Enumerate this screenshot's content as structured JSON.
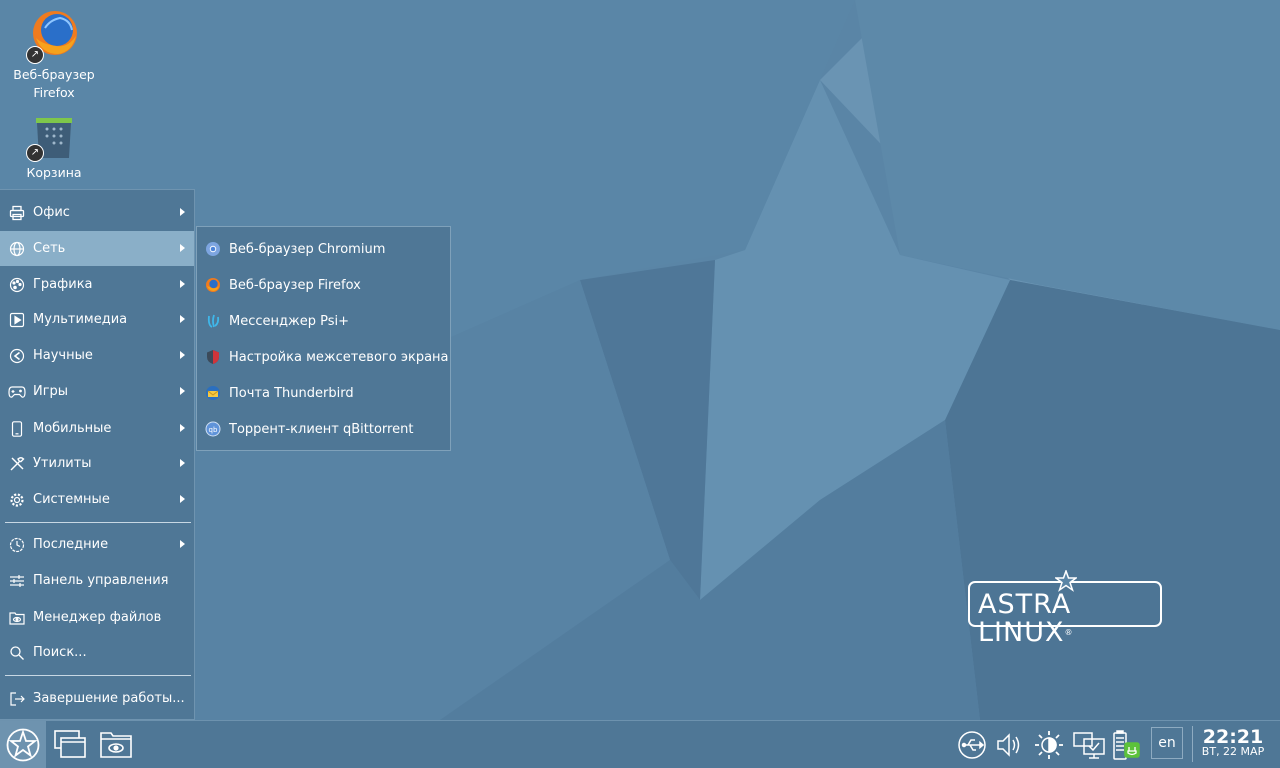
{
  "desktop": {
    "icons": [
      {
        "label": "Веб-браузер Firefox",
        "icon": "firefox-icon"
      },
      {
        "label": "Корзина",
        "icon": "trash-icon"
      }
    ],
    "logo_text": "ASTRA LINUX",
    "logo_mark": "®"
  },
  "start_menu": {
    "items": [
      {
        "label": "Офис",
        "icon": "printer-icon",
        "has_submenu": true
      },
      {
        "label": "Сеть",
        "icon": "globe-icon",
        "has_submenu": true,
        "active": true
      },
      {
        "label": "Графика",
        "icon": "palette-icon",
        "has_submenu": true
      },
      {
        "label": "Мультимедиа",
        "icon": "play-icon",
        "has_submenu": true
      },
      {
        "label": "Научные",
        "icon": "science-icon",
        "has_submenu": true
      },
      {
        "label": "Игры",
        "icon": "gamepad-icon",
        "has_submenu": true
      },
      {
        "label": "Мобильные",
        "icon": "phone-icon",
        "has_submenu": true
      },
      {
        "label": "Утилиты",
        "icon": "tools-icon",
        "has_submenu": true
      },
      {
        "label": "Системные",
        "icon": "gear-icon",
        "has_submenu": true
      }
    ],
    "bottom_items": [
      {
        "label": "Последние",
        "icon": "history-icon",
        "has_submenu": true
      },
      {
        "label": "Панель управления",
        "icon": "sliders-icon",
        "has_submenu": false
      },
      {
        "label": "Менеджер файлов",
        "icon": "file-manager-icon",
        "has_submenu": false
      },
      {
        "label": "Поиск...",
        "icon": "search-icon",
        "has_submenu": false
      }
    ],
    "shutdown_label": "Завершение работы..."
  },
  "submenu": {
    "items": [
      {
        "label": "Веб-браузер Chromium",
        "icon": "chromium-icon"
      },
      {
        "label": "Веб-браузер Firefox",
        "icon": "firefox-icon"
      },
      {
        "label": "Мессенджер Psi+",
        "icon": "psi-icon"
      },
      {
        "label": "Настройка межсетевого экрана",
        "icon": "firewall-icon"
      },
      {
        "label": "Почта Thunderbird",
        "icon": "thunderbird-icon"
      },
      {
        "label": "Торрент-клиент qBittorrent",
        "icon": "qbittorrent-icon"
      }
    ]
  },
  "taskbar": {
    "language": "en",
    "clock_time": "22:21",
    "clock_date": "ВТ, 22 МАР",
    "tray_icons": [
      "usb-icon",
      "volume-icon",
      "brightness-icon",
      "display-icon",
      "battery-icon"
    ]
  },
  "colors": {
    "panel": "#4f7796",
    "active_item": "#8aafc8",
    "wallpaper": "#5a85a6"
  }
}
